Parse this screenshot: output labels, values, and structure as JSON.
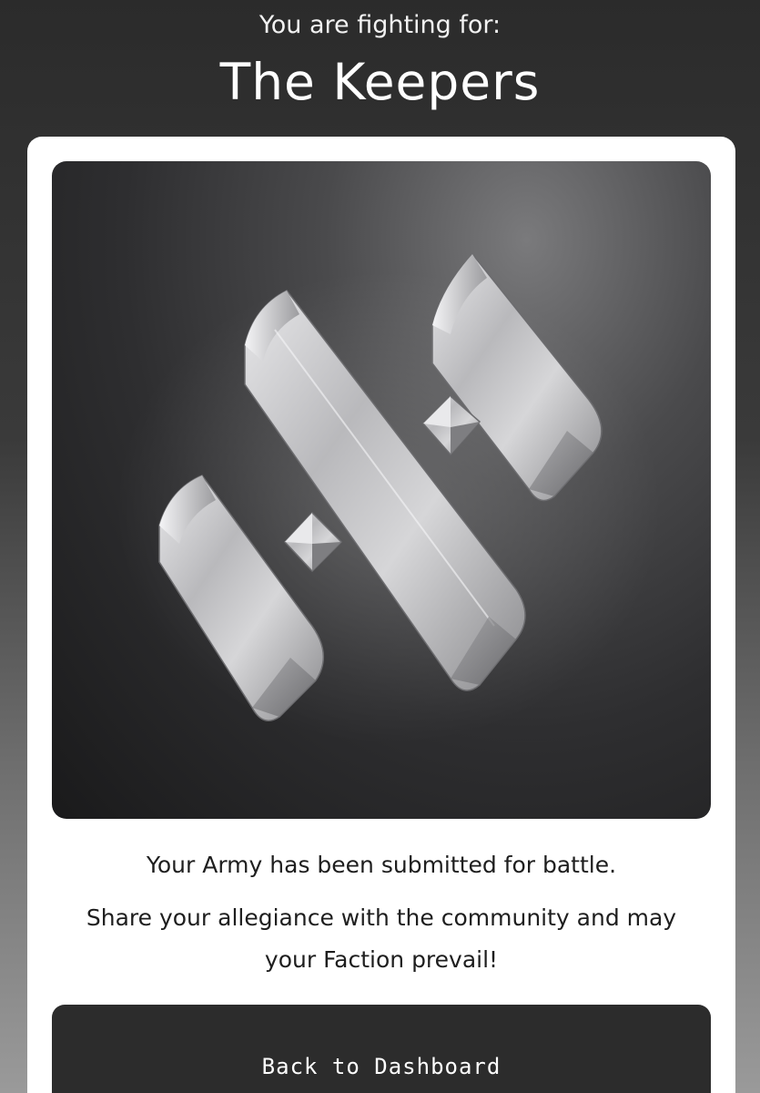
{
  "header": {
    "subtitle": "You are fighting for:",
    "faction_name": "The Keepers"
  },
  "card": {
    "emblem_icon": "faction-emblem-icon",
    "message_line_1": "Your Army has been submitted for battle.",
    "message_line_2": "Share your allegiance with the community and may your Faction prevail!",
    "button_label": "Back to Dashboard"
  },
  "colors": {
    "page_top": "#2b2b2b",
    "page_bottom": "#9a9a9a",
    "card_bg": "#ffffff",
    "button_bg": "#2c2c2c",
    "text_dark": "#1e1e1e"
  }
}
